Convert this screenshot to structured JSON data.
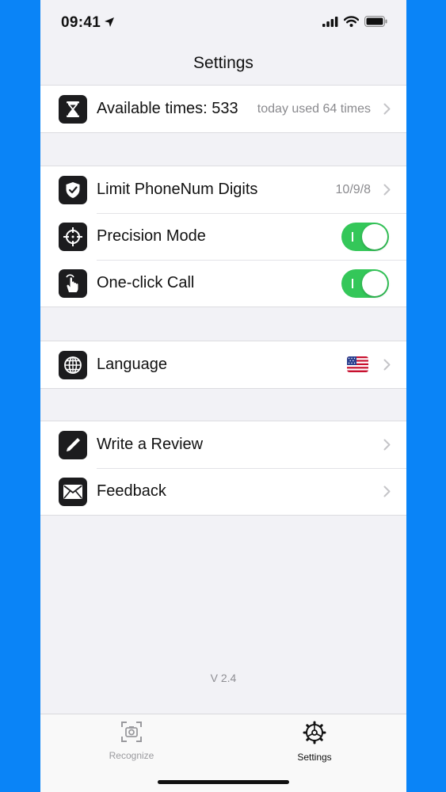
{
  "status": {
    "time": "09:41"
  },
  "nav": {
    "title": "Settings"
  },
  "groups": [
    {
      "rows": [
        {
          "label": "Available times: 533",
          "value": "today used 64 times",
          "icon": "hourglass-icon"
        }
      ]
    },
    {
      "rows": [
        {
          "label": "Limit PhoneNum Digits",
          "value": "10/9/8",
          "icon": "shield-check-icon"
        },
        {
          "label": "Precision Mode",
          "toggle": true,
          "icon": "crosshair-icon"
        },
        {
          "label": "One-click Call",
          "toggle": true,
          "icon": "tap-hand-icon"
        }
      ]
    },
    {
      "rows": [
        {
          "label": "Language",
          "flag": "us-flag",
          "icon": "globe-icon"
        }
      ]
    },
    {
      "rows": [
        {
          "label": "Write a Review",
          "icon": "pencil-icon"
        },
        {
          "label": "Feedback",
          "icon": "envelope-icon"
        }
      ]
    }
  ],
  "version": "V 2.4",
  "tabs": [
    {
      "label": "Recognize",
      "icon": "camera-scan-icon",
      "active": false
    },
    {
      "label": "Settings",
      "icon": "gear-icon",
      "active": true
    }
  ],
  "colors": {
    "toggle_on": "#34c759",
    "background": "#f2f2f6",
    "outer": "#0a84f7",
    "tab_inactive": "#9a9a9e"
  }
}
